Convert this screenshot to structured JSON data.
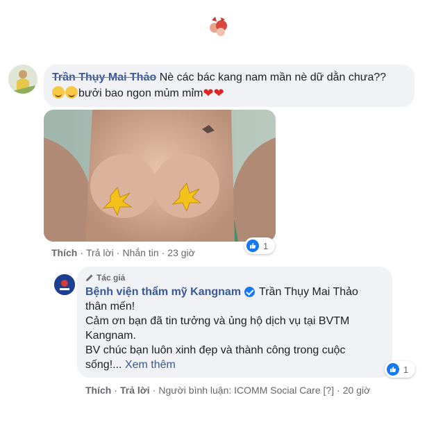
{
  "comment": {
    "author": "Trần Thụy Mai Thảo",
    "text_line1": "Nè các bác kang nam mần nè dữ dằn chưa??",
    "text_line2": "bưởi bao ngon mủm mỉm",
    "actions": {
      "like": "Thích",
      "reply": "Trả lời",
      "message": "Nhắn tin",
      "time": "23 giờ"
    },
    "reaction_count": "1"
  },
  "reply": {
    "author_badge": "Tác giả",
    "page_name": "Bệnh viện thẩm mỹ Kangnam",
    "mention": "Trần Thụy Mai Thảo",
    "line2": "thân mến!",
    "line3": "Cảm ơn bạn đã tin tưởng và ủng hộ dịch vụ tại BVTM",
    "line4": "Kangnam.",
    "line5": "BV chúc bạn luôn xinh đẹp và thành công trong cuộc",
    "line6": "sống!...",
    "see_more": "Xem thêm",
    "actions": {
      "like": "Thích",
      "reply": "Trả lời",
      "responder": "Người bình luận: ICOMM Social Care [?]",
      "time": "20 giờ"
    },
    "reaction_count": "1"
  },
  "colors": {
    "bubble": "#f0f2f5",
    "link": "#385898",
    "like_blue": "#1877f2",
    "meta": "#65676b"
  }
}
